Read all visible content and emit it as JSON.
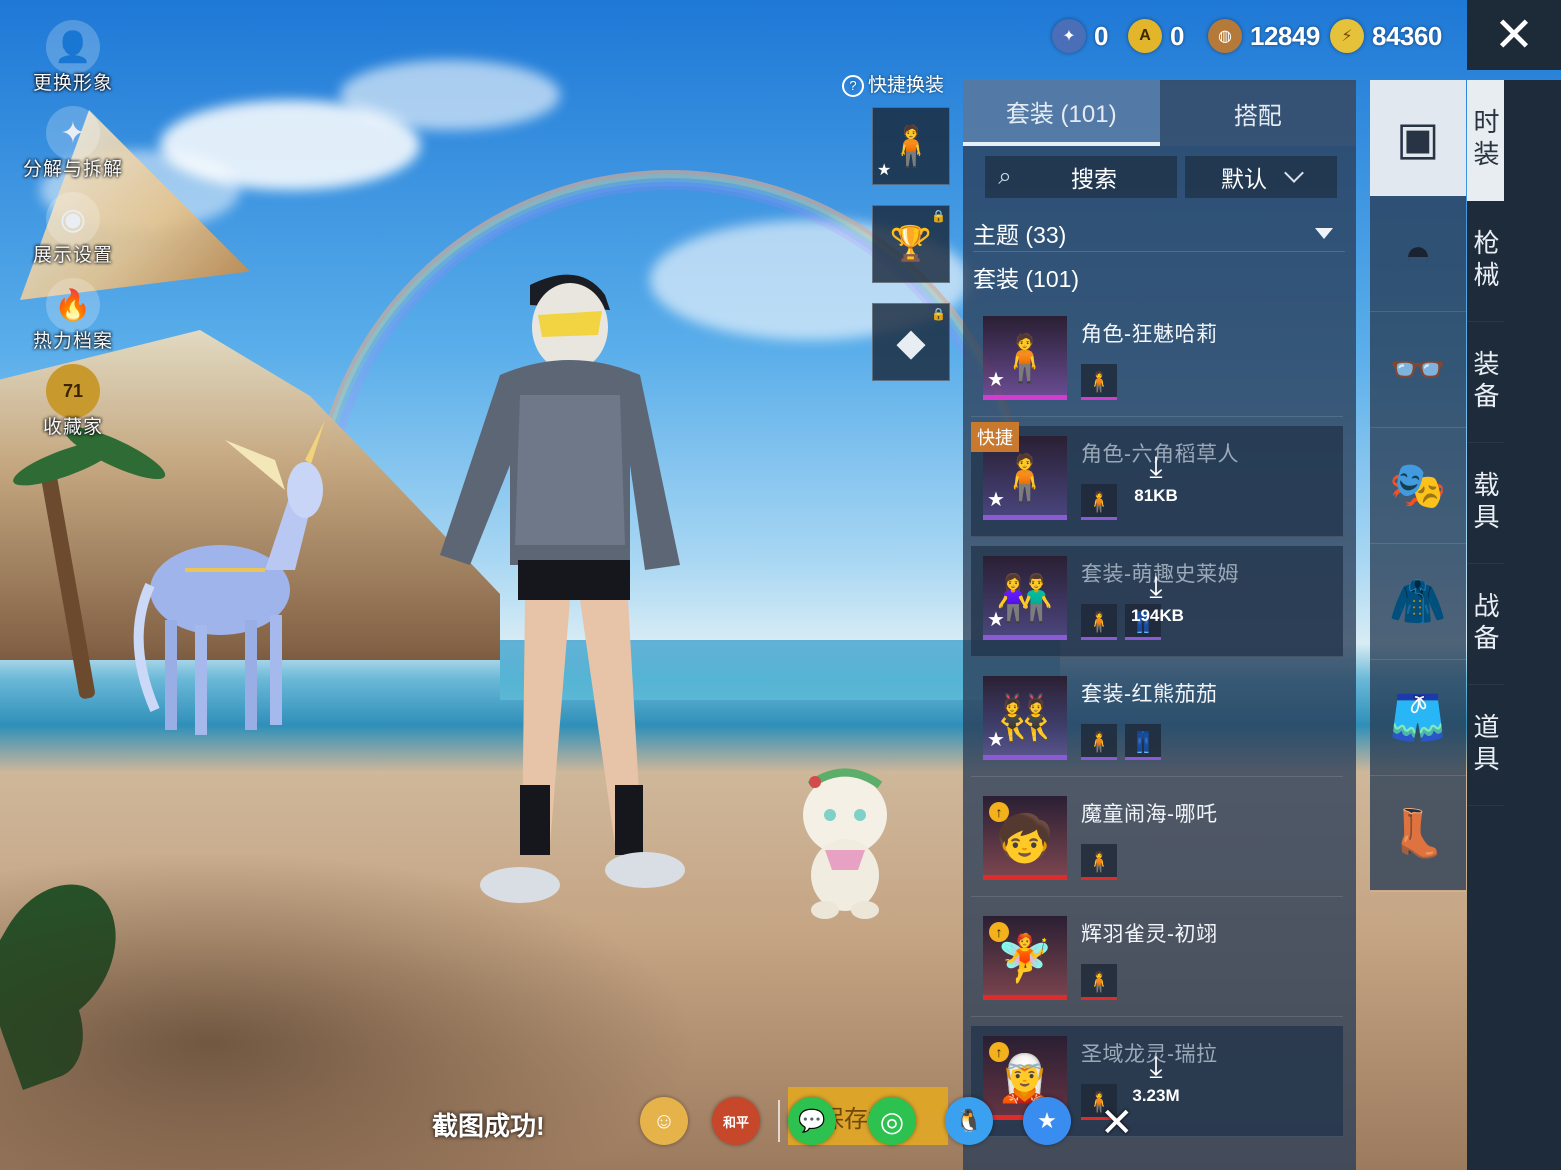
{
  "currency": [
    {
      "icon": "blue-token-icon",
      "value": "0",
      "color": "#4a6fb8"
    },
    {
      "icon": "gold-emblem-icon",
      "value": "0",
      "color": "#e2b52b"
    },
    {
      "icon": "bronze-coin-icon",
      "value": "12849",
      "color": "#b5793a"
    },
    {
      "icon": "lightning-coin-icon",
      "value": "84360",
      "color": "#e6c23a"
    }
  ],
  "left_menu": [
    {
      "icon": "avatar-icon",
      "label": "更换形象"
    },
    {
      "icon": "puzzle-icon",
      "label": "分解与拆解"
    },
    {
      "icon": "eye-icon",
      "label": "展示设置"
    },
    {
      "icon": "flame-icon",
      "label": "热力档案"
    },
    {
      "icon": "collector-badge-icon",
      "label": "收藏家",
      "badge": "71"
    }
  ],
  "quick": {
    "title": "快捷换装",
    "help": "?"
  },
  "panel": {
    "tabs": [
      {
        "label": "套装 (101)",
        "active": true
      },
      {
        "label": "搭配",
        "active": false
      }
    ],
    "search_label": "搜索",
    "sort_label": "默认",
    "theme_label": "主题 (33)",
    "set_label": "套装 (101)",
    "items": [
      {
        "name": "角色-狂魅哈莉",
        "rarity": "#d43bd0",
        "marker": "star",
        "minis": 1,
        "dim": false,
        "download": "",
        "fig": "🧍"
      },
      {
        "name": "角色-六角稻草人",
        "rarity": "#8d5ad6",
        "marker": "star",
        "minis": 1,
        "dim": true,
        "download": "81KB",
        "fig": "🧍",
        "badge": "快捷"
      },
      {
        "name": "套装-萌趣史莱姆",
        "rarity": "#8d5ad6",
        "marker": "star",
        "minis": 2,
        "dim": true,
        "download": "194KB",
        "fig": "👫"
      },
      {
        "name": "套装-红熊茄茄",
        "rarity": "#8d5ad6",
        "marker": "star",
        "minis": 2,
        "dim": false,
        "download": "",
        "fig": "👯"
      },
      {
        "name": "魔童闹海-哪吒",
        "rarity": "#e02b2b",
        "marker": "up",
        "minis": 1,
        "dim": false,
        "download": "",
        "fig": "🧒"
      },
      {
        "name": "辉羽雀灵-初翊",
        "rarity": "#e02b2b",
        "marker": "up",
        "minis": 1,
        "dim": false,
        "download": "",
        "fig": "🧚"
      },
      {
        "name": "圣域龙灵-瑞拉",
        "rarity": "#e02b2b",
        "marker": "up",
        "minis": 1,
        "dim": true,
        "download": "3.23M",
        "fig": "🧝"
      }
    ]
  },
  "sub_categories": [
    {
      "icon": "outfit-box-icon",
      "active": true
    },
    {
      "icon": "cap-icon",
      "active": false
    },
    {
      "icon": "glasses-icon",
      "active": false
    },
    {
      "icon": "mask-icon",
      "active": false
    },
    {
      "icon": "jacket-icon",
      "active": false
    },
    {
      "icon": "pants-icon",
      "active": false
    },
    {
      "icon": "shoes-icon",
      "active": false
    }
  ],
  "categories": [
    {
      "label": "时装",
      "active": true
    },
    {
      "label": "枪械",
      "active": false
    },
    {
      "label": "装备",
      "active": false
    },
    {
      "label": "载具",
      "active": false
    },
    {
      "label": "战备",
      "active": false
    },
    {
      "label": "道具",
      "active": false
    }
  ],
  "share": {
    "message": "截图成功!",
    "save_label": "保存相册",
    "buttons": [
      {
        "icon": "friend-share-icon",
        "color": "#e6b24a",
        "glyph": "☺"
      },
      {
        "icon": "peace-elite-icon",
        "color": "#c7472b",
        "glyph": "和平"
      },
      {
        "icon": "wechat-icon",
        "color": "#2dc14f",
        "glyph": "💬"
      },
      {
        "icon": "moments-icon",
        "color": "#2dc14f",
        "glyph": "◎"
      },
      {
        "icon": "qq-icon",
        "color": "#3aa0f0",
        "glyph": "🐧"
      },
      {
        "icon": "qzone-icon",
        "color": "#3a8df0",
        "glyph": "★"
      }
    ]
  }
}
